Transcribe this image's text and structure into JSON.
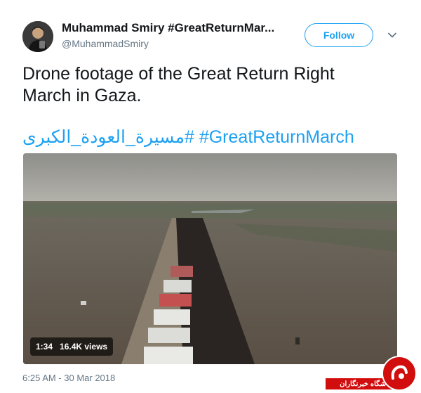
{
  "tweet": {
    "author_name": "Muhammad Smiry #GreatReturnMar...",
    "author_handle": "@MuhammadSmiry",
    "follow_label": "Follow",
    "text": "Drone footage of the Great Return Right March in Gaza.",
    "hashtags": "مسيرة_العودة_الكبرى# #GreatReturnMarch",
    "timestamp": "6:25 AM - 30 Mar 2018"
  },
  "video": {
    "duration": "1:34",
    "views": "16.4K views"
  },
  "watermark": {
    "text": "باشگاه خبرنگاران"
  },
  "colors": {
    "accent": "#1da1f2",
    "text": "#14171a",
    "secondary": "#657786",
    "watermark": "#d10d0d"
  },
  "icons": {
    "menu": "chevron-down-icon"
  }
}
